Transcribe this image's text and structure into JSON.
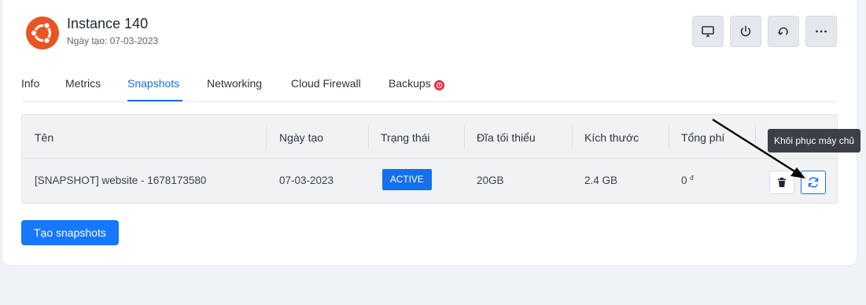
{
  "instance": {
    "name": "Instance 140",
    "created_label": "Ngày tạo: 07-03-2023",
    "os_icon": "ubuntu-logo"
  },
  "actions": [
    {
      "icon": "monitor-icon",
      "label": "Console"
    },
    {
      "icon": "power-icon",
      "label": "Power"
    },
    {
      "icon": "restart-icon",
      "label": "Restart"
    },
    {
      "icon": "more-icon",
      "label": "More"
    }
  ],
  "tabs": [
    {
      "label": "Info"
    },
    {
      "label": "Metrics"
    },
    {
      "label": "Snapshots",
      "active": true
    },
    {
      "label": "Networking"
    },
    {
      "label": "Cloud Firewall"
    },
    {
      "label": "Backups",
      "badge": "alarm-icon"
    }
  ],
  "table": {
    "headers": [
      "Tên",
      "Ngày tạo",
      "Trạng thái",
      "Đĩa tối thiểu",
      "Kích thước",
      "Tổng phí"
    ],
    "rows": [
      {
        "name": "[SNAPSHOT] website - 1678173580",
        "created": "07-03-2023",
        "status": "ACTIVE",
        "min_disk": "20GB",
        "size": "2.4 GB",
        "total_fee": "0",
        "currency": "đ"
      }
    ]
  },
  "tooltip": "Khôi phục máy chủ",
  "create_button": "Tạo snapshots",
  "colors": {
    "accent": "#1671e8",
    "danger": "#e42b3b",
    "ubuntu": "#e95420"
  }
}
